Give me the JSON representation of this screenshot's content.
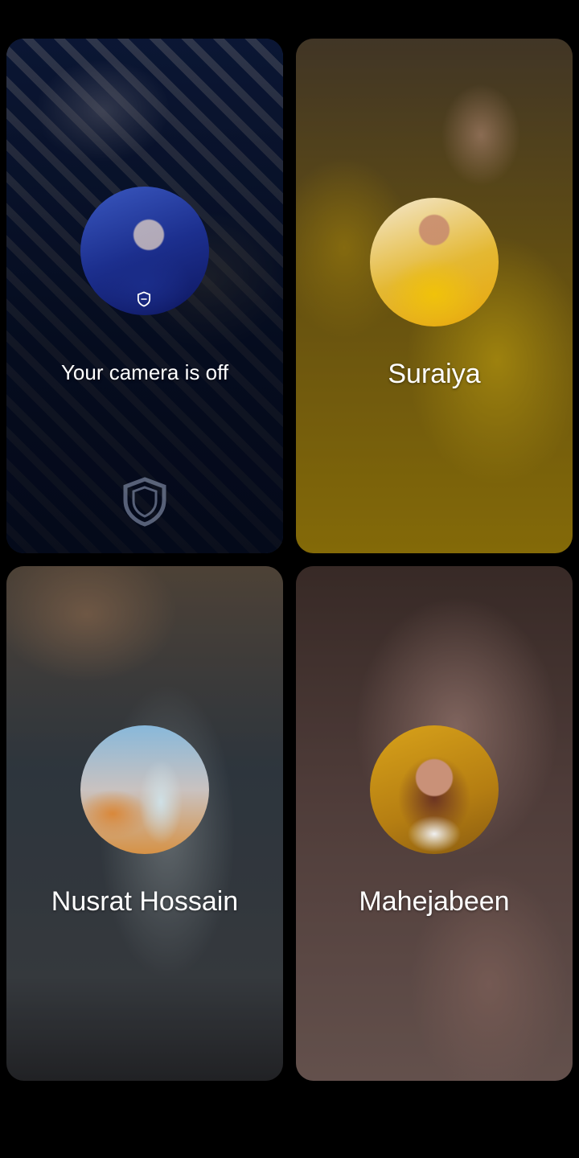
{
  "tiles": [
    {
      "id": "self",
      "label": "Your camera is off",
      "camera_on": false,
      "shield_icon": "shield-icon"
    },
    {
      "id": "participant-1",
      "label": "Suraiya"
    },
    {
      "id": "participant-2",
      "label": "Nusrat Hossain"
    },
    {
      "id": "participant-3",
      "label": "Mahejabeen"
    }
  ],
  "colors": {
    "background": "#000000",
    "label_text": "#ffffff"
  }
}
